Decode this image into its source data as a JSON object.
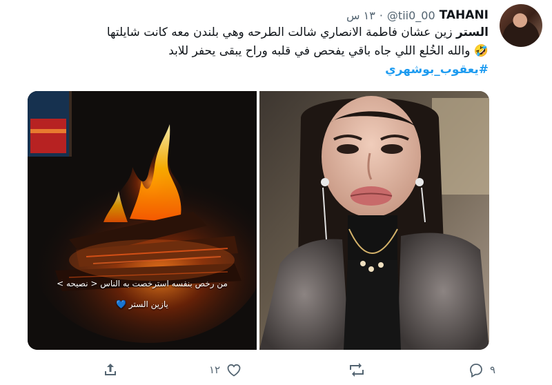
{
  "tweet": {
    "name": "TAHANI",
    "handle": "@tii0_00",
    "dot": "·",
    "time": "١٣ س",
    "lines": [
      {
        "bold": "الستر",
        "text": " زين عشان فاطمة الانصاري شالت الطرحه وهي بلندن معه كانت شايلتها"
      },
      {
        "text": "🤣 والله الخُلع اللي جاه باقي يفحص في قلبه وراح يبقى يحفر للابد"
      }
    ],
    "hashtag": "#يعقوب_بوشهري"
  },
  "media": {
    "left_caption_1": "من رخص بنفسه استرخصت به الناس < نصيحه >",
    "left_caption_2": "يازين الستر 💙"
  },
  "actions": {
    "reply_count": "٩",
    "retweet_count": "",
    "like_count": "١٢",
    "share_count": ""
  },
  "colors": {
    "accent": "#1d9bf0",
    "muted": "#536471",
    "text": "#0f1419"
  }
}
